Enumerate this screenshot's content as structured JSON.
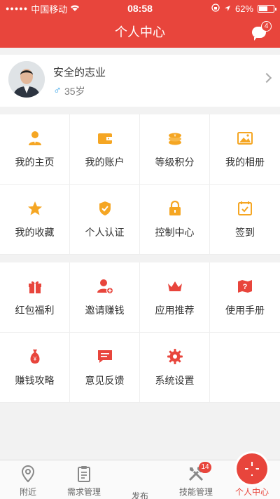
{
  "status_bar": {
    "signal": "●●●●●",
    "carrier": "中国移动",
    "time": "08:58",
    "battery": "62%",
    "battery_level": 0.62
  },
  "header": {
    "title": "个人中心",
    "message_count": "4"
  },
  "profile": {
    "name": "安全的志业",
    "gender_icon": "male-icon",
    "age": "35岁"
  },
  "menu_group_1": [
    {
      "label": "我的主页",
      "icon": "user-icon"
    },
    {
      "label": "我的账户",
      "icon": "wallet-icon"
    },
    {
      "label": "等级积分",
      "icon": "coins-icon"
    },
    {
      "label": "我的相册",
      "icon": "image-icon"
    },
    {
      "label": "我的收藏",
      "icon": "star-icon"
    },
    {
      "label": "个人认证",
      "icon": "shield-check-icon"
    },
    {
      "label": "控制中心",
      "icon": "lock-icon"
    },
    {
      "label": "签到",
      "icon": "calendar-check-icon"
    }
  ],
  "menu_group_2": [
    {
      "label": "红包福利",
      "icon": "gift-icon"
    },
    {
      "label": "邀请赚钱",
      "icon": "add-user-icon"
    },
    {
      "label": "应用推荐",
      "icon": "crown-icon"
    },
    {
      "label": "使用手册",
      "icon": "map-help-icon"
    },
    {
      "label": "赚钱攻略",
      "icon": "money-bag-icon"
    },
    {
      "label": "意见反馈",
      "icon": "feedback-icon"
    },
    {
      "label": "系统设置",
      "icon": "gear-icon"
    }
  ],
  "tabbar": [
    {
      "label": "附近",
      "icon": "location-pin-icon"
    },
    {
      "label": "需求管理",
      "icon": "clipboard-icon"
    },
    {
      "label": "发布",
      "icon": "plus-icon"
    },
    {
      "label": "技能管理",
      "icon": "tools-icon",
      "badge": "14"
    },
    {
      "label": "个人中心",
      "icon": "person-icon",
      "active": true
    }
  ],
  "colors": {
    "brand": "#e8453c",
    "icon_orange": "#f5a623",
    "icon_red": "#e8453c",
    "male_blue": "#3aa4e8"
  }
}
